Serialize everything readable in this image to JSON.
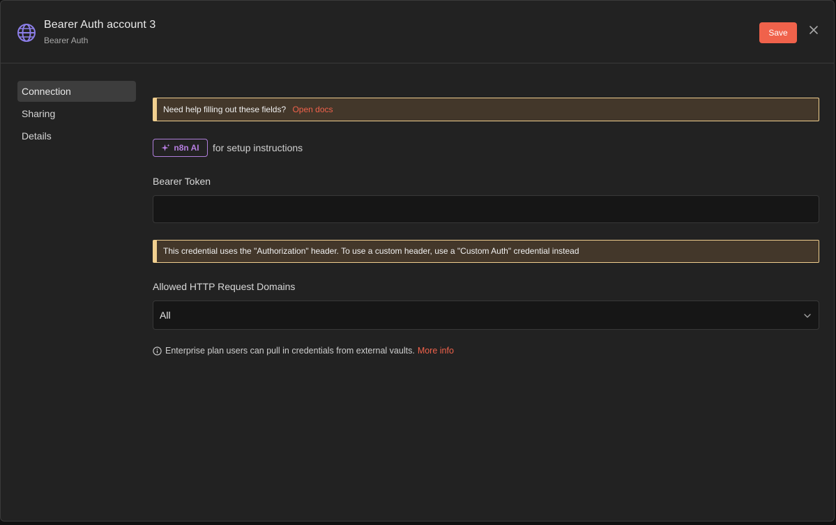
{
  "header": {
    "title": "Bearer Auth account 3",
    "subtitle": "Bearer Auth",
    "save_label": "Save"
  },
  "sidebar": {
    "items": [
      {
        "label": "Connection",
        "active": true
      },
      {
        "label": "Sharing",
        "active": false
      },
      {
        "label": "Details",
        "active": false
      }
    ]
  },
  "help_notice": {
    "text": "Need help filling out these fields?",
    "link": "Open docs"
  },
  "ai": {
    "badge": "n8n AI",
    "text": "for setup instructions"
  },
  "token_field": {
    "label": "Bearer Token",
    "value": ""
  },
  "header_notice": {
    "text": "This credential uses the \"Authorization\" header. To use a custom header, use a \"Custom Auth\" credential instead"
  },
  "domains_field": {
    "label": "Allowed HTTP Request Domains",
    "value": "All"
  },
  "footnote": {
    "text": "Enterprise plan users can pull in credentials from external vaults.",
    "link": "More info"
  },
  "colors": {
    "accent": "#f0624b",
    "ai": "#b67ee0",
    "warning_border": "#f1cf8f"
  },
  "icons": {
    "credential": "globe-icon",
    "close": "close-icon",
    "ai": "sparkle-icon",
    "dropdown": "chevron-down-icon",
    "info": "info-icon"
  }
}
